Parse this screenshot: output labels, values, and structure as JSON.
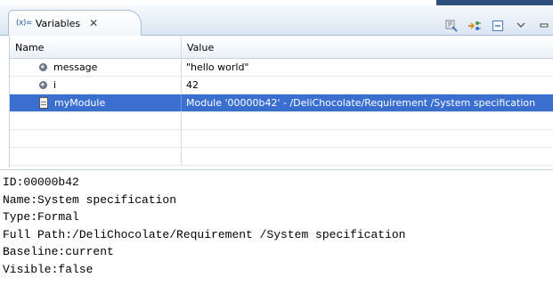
{
  "view": {
    "tab_icon": "(x)=",
    "tab_title": "Variables",
    "tab_close_glyph": "✕"
  },
  "toolbar": {
    "icons": [
      "show-type-names-icon",
      "show-logical-structure-icon",
      "collapse-all-icon",
      "view-menu-icon",
      "minimize-icon"
    ]
  },
  "table": {
    "columns": {
      "name": "Name",
      "value": "Value"
    },
    "rows": [
      {
        "name": "message",
        "value": "\"hello world\"",
        "icon": "local-variable-icon",
        "selected": false
      },
      {
        "name": "i",
        "value": "42",
        "icon": "local-variable-icon",
        "selected": false
      },
      {
        "name": "myModule",
        "value": "Module '00000b42' - /DeliChocolate/Requirement /System specification",
        "icon": "document-icon",
        "selected": true
      }
    ]
  },
  "details": {
    "lines": [
      "ID:00000b42",
      "Name:System specification",
      "Type:Formal",
      "Full Path:/DeliChocolate/Requirement /System specification",
      "Baseline:current",
      "Visible:false"
    ]
  },
  "colors": {
    "selection": "#3a6fcf",
    "border": "#a7bcd9",
    "corner": "#2d4f7e"
  }
}
